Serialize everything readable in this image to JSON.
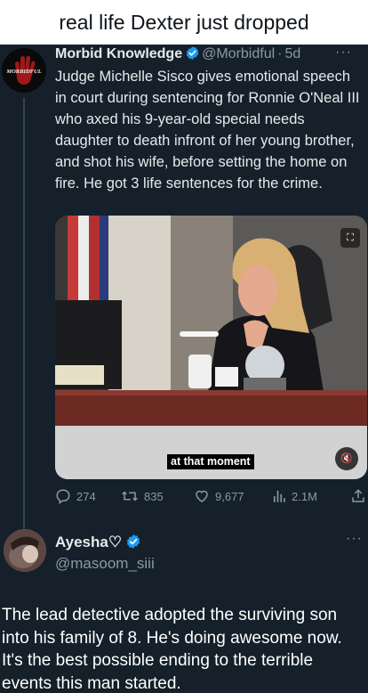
{
  "meme_caption": "real life Dexter just dropped",
  "tweet": {
    "author_name": "Morbid Knowledge",
    "author_handle": "@Morbidful",
    "separator": "·",
    "time_ago": "5d",
    "avatar_text": "MORBIDFUL",
    "text": "Judge Michelle Sisco gives emotional speech in court during sentencing for Ronnie O'Neal III who axed his 9-year-old special needs daughter to death infront of her young brother, and shot his wife, before setting the home on fire. He got 3 life sentences for the crime.",
    "video_caption": "at that moment",
    "stats": {
      "replies": "274",
      "retweets": "835",
      "likes": "9,677",
      "views": "2.1M"
    }
  },
  "reply": {
    "name": "Ayesha♡",
    "handle": "@masoom_siii"
  },
  "comment": "The lead detective adopted the surviving son into his family of 8. He's doing awesome now. It's the best possible ending to the terrible events this man started.",
  "icons": {
    "verified": "verified-badge-icon",
    "reply": "reply-icon",
    "retweet": "retweet-icon",
    "like": "heart-icon",
    "views": "views-icon",
    "share": "share-icon"
  },
  "colors": {
    "tweet_background": "#15202b",
    "verified_blue": "#1d9bf0",
    "secondary_text": "#8b98a5"
  }
}
